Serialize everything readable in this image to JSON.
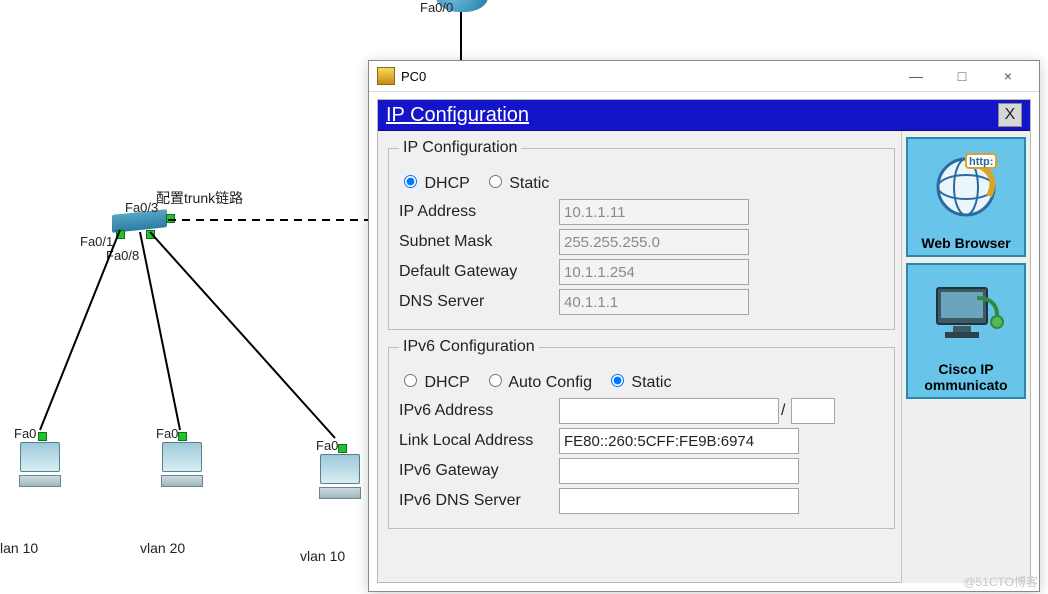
{
  "topology": {
    "router_port": "Fa0/0",
    "trunk_label": "配置trunk链路",
    "switch_ports": {
      "p3": "Fa0/3",
      "p1": "Fa0/1",
      "p8": "Fa0/8"
    },
    "pc_ports": {
      "a": "Fa0",
      "b": "Fa0",
      "c": "Fa0"
    },
    "vlan_labels": {
      "a": "lan 10",
      "b": "vlan 20",
      "c": "vlan 10"
    }
  },
  "dialog": {
    "window_title": "PC0",
    "header": "IP Configuration",
    "winbtns": {
      "min": "—",
      "max": "□",
      "close": "×"
    },
    "close_x": "X",
    "ipv4": {
      "legend": "IP Configuration",
      "mode_dhcp": "DHCP",
      "mode_static": "Static",
      "mode_selected": "dhcp",
      "ip_label": "IP Address",
      "ip_value": "10.1.1.11",
      "mask_label": "Subnet Mask",
      "mask_value": "255.255.255.0",
      "gw_label": "Default Gateway",
      "gw_value": "10.1.1.254",
      "dns_label": "DNS Server",
      "dns_value": "40.1.1.1"
    },
    "ipv6": {
      "legend": "IPv6 Configuration",
      "mode_dhcp": "DHCP",
      "mode_auto": "Auto Config",
      "mode_static": "Static",
      "mode_selected": "static",
      "addr_label": "IPv6 Address",
      "addr_value": "",
      "prefix_sep": "/",
      "prefix_value": "",
      "lla_label": "Link Local Address",
      "lla_value": "FE80::260:5CFF:FE9B:6974",
      "gw_label": "IPv6 Gateway",
      "gw_value": "",
      "dns_label": "IPv6 DNS Server",
      "dns_value": ""
    },
    "side": {
      "web": "Web Browser",
      "web_tag": "http:",
      "cip": "Cisco IP Communicator",
      "cip_display": "Cisco IP ommunicato"
    }
  },
  "watermark": "@51CTO博客"
}
